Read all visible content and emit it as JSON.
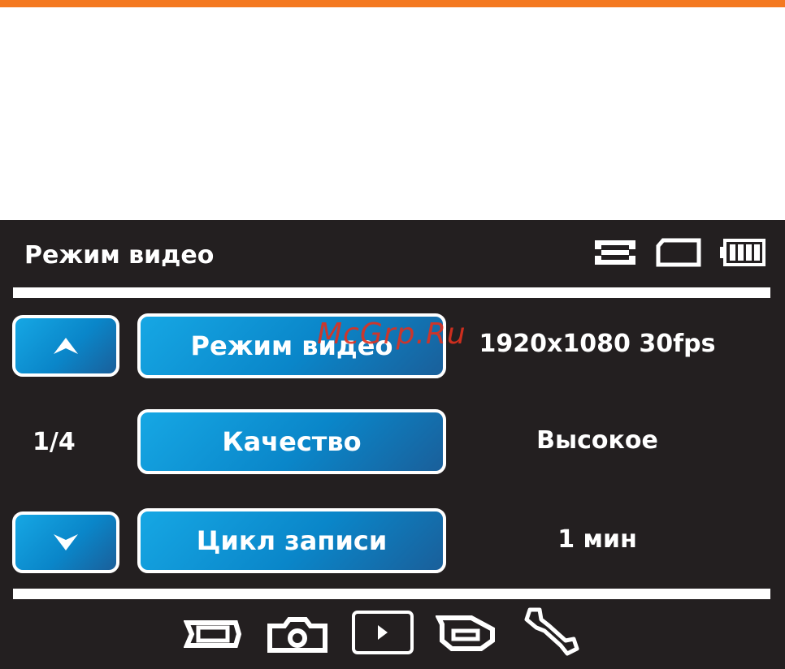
{
  "header": {
    "title": "Режим видео"
  },
  "status_icons": [
    "film-strip-icon",
    "sd-card-icon",
    "battery-icon"
  ],
  "menu": {
    "page_indicator": "1/4",
    "items": [
      {
        "label": "Режим видео",
        "value": "1920x1080 30fps"
      },
      {
        "label": "Качество",
        "value": "Высокое"
      },
      {
        "label": "Цикл записи",
        "value": "1 мин"
      }
    ]
  },
  "watermark": "McGrp.Ru",
  "bottom_nav": [
    "video-mode-icon",
    "photo-camera-icon",
    "playback-icon",
    "rotate-icon",
    "settings-wrench-icon"
  ],
  "colors": {
    "accent_orange": "#f47920",
    "screen_bg": "#231f20",
    "button_blue": "#16a7e4"
  }
}
